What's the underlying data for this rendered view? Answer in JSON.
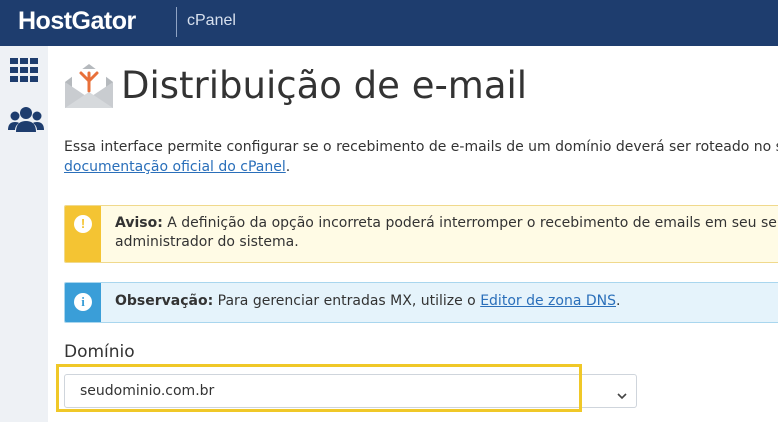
{
  "header": {
    "brand": "HostGator",
    "product": "cPanel"
  },
  "sidebar": {
    "items": [
      {
        "icon": "grid-icon"
      },
      {
        "icon": "users-icon"
      }
    ]
  },
  "page": {
    "title": "Distribuição de e-mail",
    "description_line1": "Essa interface permite configurar se o recebimento de e-mails de um domínio deverá ser roteado no servidor",
    "description_link": "documentação oficial do cPanel",
    "description_end": "."
  },
  "warning": {
    "label": "Aviso:",
    "text_line1": "A definição da opção incorreta poderá interromper o recebimento de emails em seu servidor. S",
    "text_line2": "administrador do sistema.",
    "icon": "!"
  },
  "info": {
    "label": "Observação:",
    "text": "Para gerenciar entradas MX, utilize o",
    "link": "Editor de zona DNS",
    "end": ".",
    "icon": "i"
  },
  "domain_field": {
    "label": "Domínio",
    "value": "seudominio.com.br"
  },
  "colors": {
    "header": "#1e3d6e",
    "warning": "#f4c433",
    "info": "#3a9ed8",
    "highlight": "#f0c828",
    "link": "#2a6fba"
  }
}
